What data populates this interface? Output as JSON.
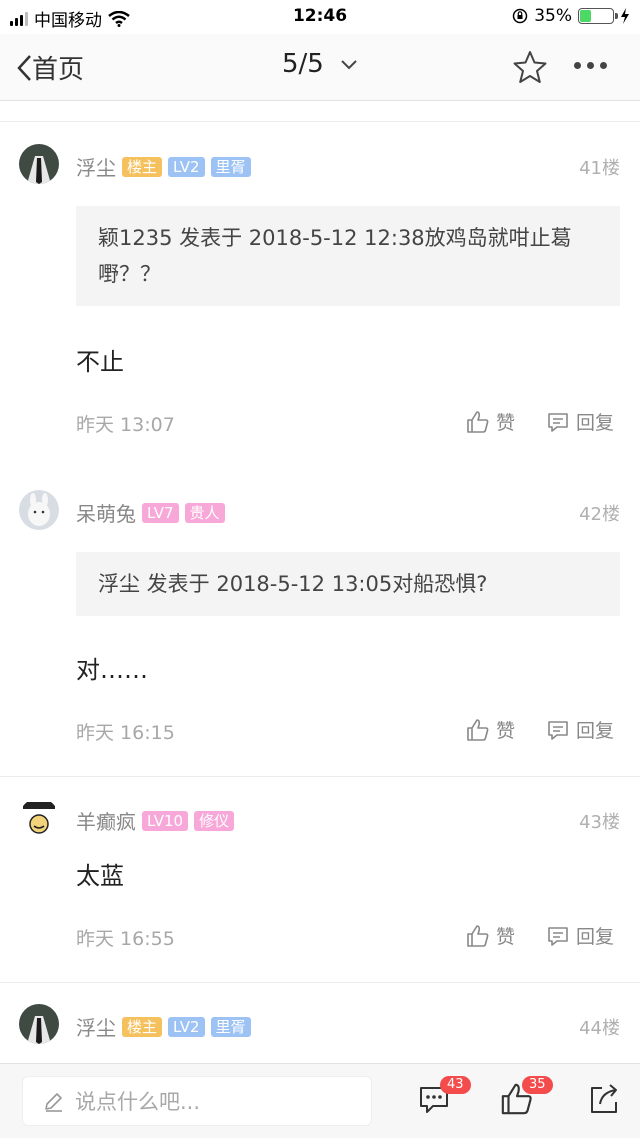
{
  "status": {
    "carrier": "中国移动",
    "time": "12:46",
    "battery": "35%",
    "battery_level": 0.35
  },
  "nav": {
    "back_label": "首页",
    "page": "5/5"
  },
  "posts": [
    {
      "username": "浮尘",
      "badges": [
        "楼主",
        "LV2",
        "里胥"
      ],
      "floor": "41楼",
      "quote": "颖1235 发表于 2018-5-12 12:38放鸡岛就咁止葛嘢？？",
      "content": "不止",
      "time": "昨天 13:07",
      "like_label": "赞",
      "reply_label": "回复"
    },
    {
      "username": "呆萌兔",
      "badges": [
        "LV7",
        "贵人"
      ],
      "floor": "42楼",
      "quote": "浮尘 发表于 2018-5-12 13:05对船恐惧?",
      "content": "对……",
      "time": "昨天 16:15",
      "like_label": "赞",
      "reply_label": "回复"
    },
    {
      "username": "羊癫疯",
      "badges": [
        "LV10",
        "修仪"
      ],
      "floor": "43楼",
      "content": "太蓝",
      "time": "昨天 16:55",
      "like_label": "赞",
      "reply_label": "回复"
    },
    {
      "username": "浮尘",
      "badges": [
        "楼主",
        "LV2",
        "里胥"
      ],
      "floor": "44楼"
    }
  ],
  "bottom": {
    "placeholder": "说点什么吧...",
    "comments_count": "43",
    "likes_count": "35"
  },
  "icons": [
    "signal-icon",
    "wifi-icon",
    "lock-rotation-icon",
    "battery-icon",
    "charging-icon",
    "back-chevron-icon",
    "dropdown-chevron-icon",
    "star-icon",
    "more-icon",
    "like-icon",
    "reply-icon",
    "pencil-icon",
    "comment-icon",
    "share-icon"
  ],
  "colors": {
    "host_badge": "#f5c15f",
    "level_badge": "#9dc3f5",
    "pink_badge": "#f7a8d8",
    "count_badge": "#f44c4c",
    "charging": "#4cd964"
  }
}
